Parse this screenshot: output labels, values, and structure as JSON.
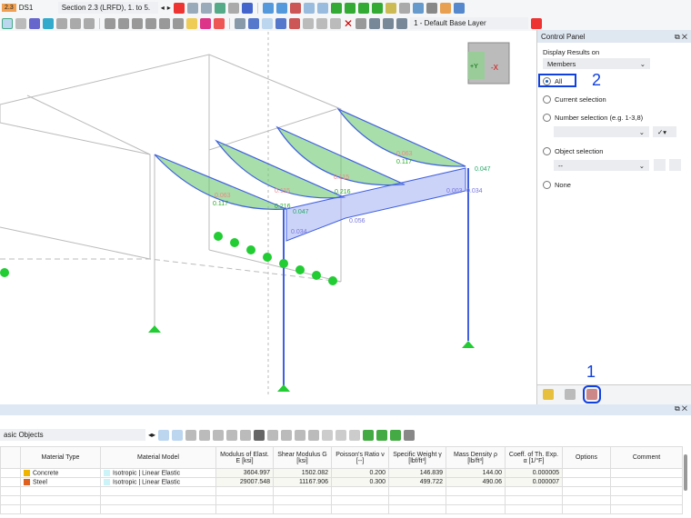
{
  "toolbar": {
    "badge": "2.3",
    "design_situation": "DS1",
    "combo": "Section 2.3 (LRFD), 1. to 5.",
    "layer": "1 - Default Base Layer"
  },
  "viewport": {
    "labels": {
      "l1": "0.063",
      "l2": "0.117",
      "l3": "0.115",
      "l4": "0.216",
      "l5": "0.115",
      "l6": "0.216",
      "l7": "0.063",
      "l8": "0.117",
      "l9": "0.047",
      "l10": "0.047",
      "l11": "0.034",
      "l12": "0.056",
      "l13": "0.003",
      "l14": "0.034"
    },
    "cube_labels": {
      "y": "+Y",
      "x": "-X"
    }
  },
  "control_panel": {
    "title": "Control Panel",
    "display_label": "Display Results on",
    "display_value": "Members",
    "options": [
      "All",
      "Current selection",
      "Number selection (e.g. 1-3,8)",
      "Object selection",
      "None"
    ],
    "object_sel_value": "--",
    "selected": "All",
    "callout_2": "2",
    "callout_1": "1"
  },
  "bottom": {
    "filter": "asic Objects",
    "columns": [
      "Material Type",
      "Material Model",
      "Modulus of Elast. E [ksi]",
      "Shear Modulus G [ksi]",
      "Poisson's Ratio ν [--]",
      "Specific Weight γ [lbf/ft³]",
      "Mass Density ρ [lb/ft³]",
      "Coeff. of Th. Exp. α [1/°F]",
      "Options",
      "Comment"
    ],
    "rows": [
      {
        "type": "Concrete",
        "color": "#f0b400",
        "model": "Isotropic | Linear Elastic",
        "E": "3604.997",
        "G": "1502.082",
        "nu": "0.200",
        "gamma": "146.839",
        "rho": "144.00",
        "alpha": "0.000005"
      },
      {
        "type": "Steel",
        "color": "#e06020",
        "model": "Isotropic | Linear Elastic",
        "E": "29007.548",
        "G": "11167.906",
        "nu": "0.300",
        "gamma": "499.722",
        "rho": "490.06",
        "alpha": "0.000007"
      }
    ]
  }
}
